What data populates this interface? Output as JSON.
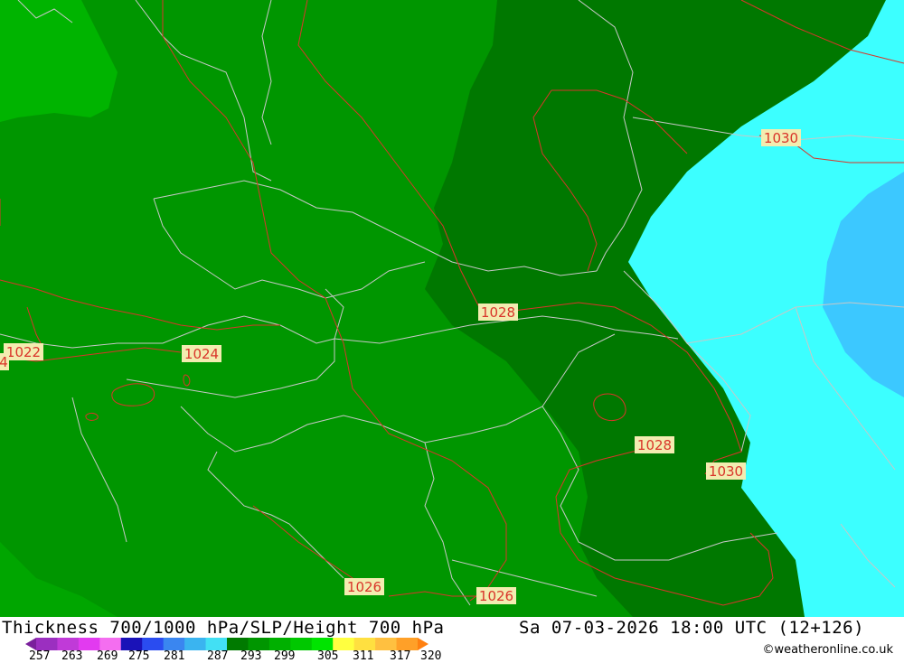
{
  "title": {
    "left": "Thickness 700/1000 hPa/SLP/Height 700 hPa",
    "right": "Sa 07-03-2026 18:00 UTC (12+126)"
  },
  "legend": {
    "ticks": [
      "257",
      "263",
      "269",
      "275",
      "281",
      "287",
      "293",
      "299",
      "305",
      "311",
      "317",
      "320"
    ],
    "colors": [
      "#7a1f9c",
      "#9b2fc0",
      "#c03ad8",
      "#e23af0",
      "#f46ef0",
      "#1a12b8",
      "#2a4cf0",
      "#3a86f0",
      "#3ab4f0",
      "#42e0f4",
      "#007a00",
      "#009600",
      "#00b000",
      "#00c800",
      "#00e400",
      "#ffff40",
      "#ffe040",
      "#ffc040",
      "#ffa028",
      "#ff8010"
    ]
  },
  "credit": "©weatheronline.co.uk",
  "isobar_labels": [
    {
      "text": "1030"
    },
    {
      "text": "1028"
    },
    {
      "text": "1022"
    },
    {
      "text": "1024"
    },
    {
      "text": "1028"
    },
    {
      "text": "1030"
    },
    {
      "text": "1026"
    },
    {
      "text": "1026"
    },
    {
      "text": "4"
    }
  ],
  "map_colors": {
    "green_light": "#00b400",
    "green_mid": "#009600",
    "green_dark": "#007800",
    "cyan": "#3cffff",
    "cyan_deep": "#3cc8ff",
    "isobar": "#d9352a",
    "border": "#c8c8c8"
  }
}
